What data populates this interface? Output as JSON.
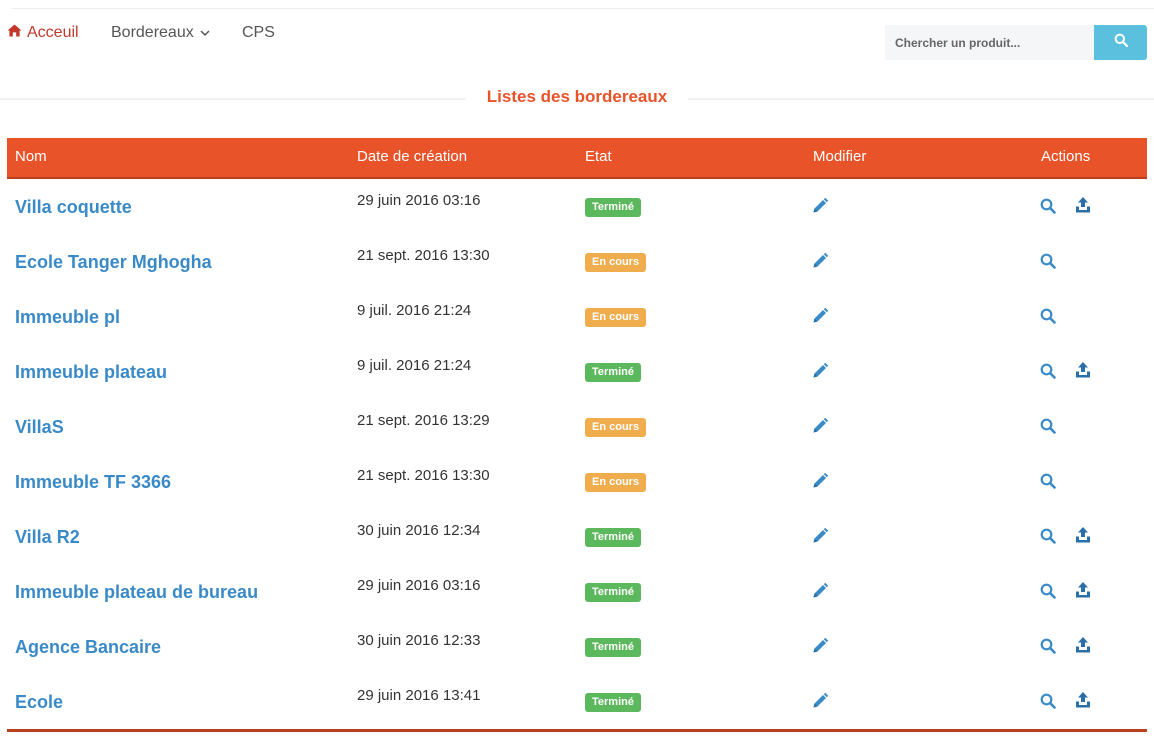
{
  "nav": {
    "home_label": "Acceuil",
    "home_icon": "home-icon",
    "bordereaux_label": "Bordereaux",
    "dropdown_icon": "chevron-down-icon",
    "cps_label": "CPS",
    "active_color": "#c0392b"
  },
  "search": {
    "placeholder": "Chercher un produit...",
    "button_icon": "search-icon",
    "button_color": "#5bc0de"
  },
  "page": {
    "title": "Listes des bordereaux",
    "accent_color": "#e8532a"
  },
  "table": {
    "headers": {
      "nom": "Nom",
      "date": "Date de création",
      "etat": "Etat",
      "modifier": "Modifier",
      "actions": "Actions"
    },
    "status_colors": {
      "Terminé": "#5cb85c",
      "En cours": "#f0ad4e"
    },
    "icons": {
      "edit": "pencil-icon",
      "view": "search-icon",
      "export": "upload-icon"
    },
    "rows": [
      {
        "nom": "Villa coquette",
        "date": "29 juin 2016 03:16",
        "etat": "Terminé",
        "export": true
      },
      {
        "nom": "Ecole Tanger Mghogha",
        "date": "21 sept. 2016 13:30",
        "etat": "En cours",
        "export": false
      },
      {
        "nom": "Immeuble pl",
        "date": "9 juil. 2016 21:24",
        "etat": "En cours",
        "export": false
      },
      {
        "nom": "Immeuble plateau",
        "date": "9 juil. 2016 21:24",
        "etat": "Terminé",
        "export": true
      },
      {
        "nom": "VillaS",
        "date": "21 sept. 2016 13:29",
        "etat": "En cours",
        "export": false
      },
      {
        "nom": "Immeuble TF 3366",
        "date": "21 sept. 2016 13:30",
        "etat": "En cours",
        "export": false
      },
      {
        "nom": "Villa R2",
        "date": "30 juin 2016 12:34",
        "etat": "Terminé",
        "export": true
      },
      {
        "nom": "Immeuble plateau de bureau",
        "date": "29 juin 2016 03:16",
        "etat": "Terminé",
        "export": true
      },
      {
        "nom": "Agence Bancaire",
        "date": "30 juin 2016 12:33",
        "etat": "Terminé",
        "export": true
      },
      {
        "nom": "Ecole",
        "date": "29 juin 2016 13:41",
        "etat": "Terminé",
        "export": true
      }
    ]
  }
}
